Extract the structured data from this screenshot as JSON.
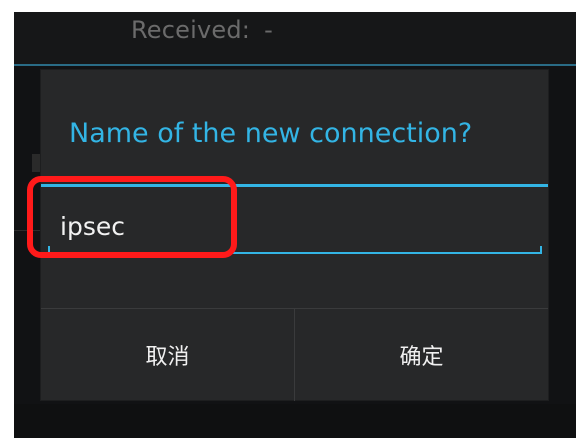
{
  "background": {
    "received_label": "Received:",
    "received_value": "-"
  },
  "dialog": {
    "title": "Name of the new connection?",
    "input_value": "ipsec",
    "cancel_label": "取消",
    "ok_label": "确定"
  },
  "colors": {
    "accent": "#33b5e5",
    "highlight": "#ff1a1a",
    "dialog_bg": "#272829",
    "screen_bg": "#111214"
  }
}
